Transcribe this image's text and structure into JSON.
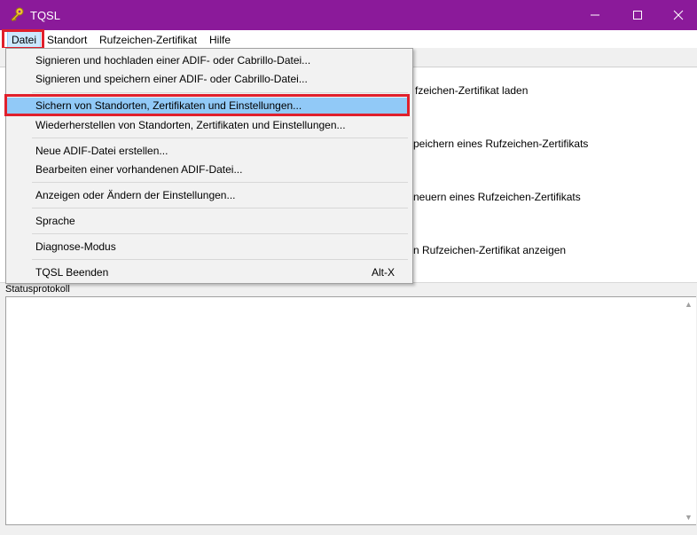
{
  "window": {
    "title": "TQSL",
    "controls": {
      "minimize": "—",
      "maximize": "☐",
      "close": "✕"
    }
  },
  "menubar": {
    "items": [
      "Datei",
      "Standort",
      "Rufzeichen-Zertifikat",
      "Hilfe"
    ]
  },
  "file_menu": {
    "items": [
      "Signieren und hochladen einer ADIF- oder Cabrillo-Datei...",
      "Signieren und speichern einer ADIF- oder Cabrillo-Datei...",
      "Sichern von Standorten, Zertifikaten und Einstellungen...",
      "Wiederherstellen von Standorten, Zertifikaten und Einstellungen...",
      "Neue ADIF-Datei erstellen...",
      "Bearbeiten einer vorhandenen ADIF-Datei...",
      "Anzeigen oder Ändern der Einstellungen...",
      "Sprache",
      "Diagnose-Modus",
      "TQSL Beenden"
    ],
    "selected_index": 2,
    "exit_shortcut": "Alt-X"
  },
  "main": {
    "action_fragments": [
      "fzeichen-Zertifikat laden",
      "peichern eines Rufzeichen-Zertifikats",
      "neuern eines Rufzeichen-Zertifikats",
      "n Rufzeichen-Zertifikat anzeigen"
    ],
    "status_label": "Statusprotokoll"
  },
  "colors": {
    "titlebar": "#8b1a9a",
    "selection": "#91c9f7",
    "highlight_box": "#e0202c"
  }
}
